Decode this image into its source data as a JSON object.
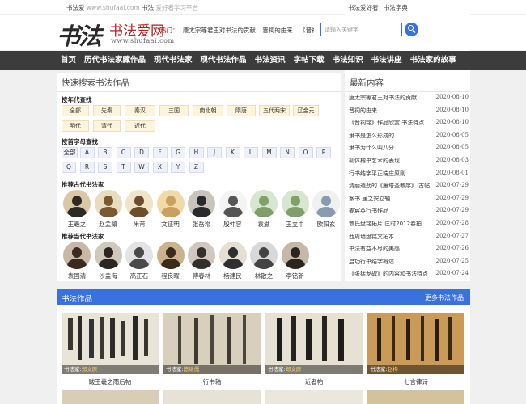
{
  "topbar": {
    "site": "书法爱",
    "url": "www.shufaai.com",
    "brand": "书法",
    "slogan": "爱好者学习平台",
    "links": [
      "书法爱好者",
      "书法字典"
    ]
  },
  "header": {
    "logo_text": "书法",
    "logo_red": "书法爱网",
    "logo_url": "www.shufaai.com",
    "hot_label": "热门：",
    "hot_items": [
      "唐太宗等君王对书法的贡献",
      "晋祠的由来",
      "《晋祠"
    ],
    "search_placeholder": "请输入关键字"
  },
  "nav": [
    "首页",
    "历代书法家藏作品",
    "现代书法家",
    "现代书法作品",
    "书法资讯",
    "字帖下载",
    "书法知识",
    "书法讲座",
    "书法家的故事"
  ],
  "search_panel": {
    "title": "快速搜索书法作品",
    "dynasty_title": "按年代查找",
    "dynasties": [
      "全部",
      "先秦",
      "秦汉",
      "三国",
      "南北朝",
      "隋唐",
      "五代两宋",
      "辽金元",
      "明代",
      "清代",
      "近代"
    ],
    "letter_title": "按首字母查找",
    "letters": [
      "全部",
      "A",
      "B",
      "C",
      "D",
      "F",
      "G",
      "H",
      "J",
      "K",
      "L",
      "M",
      "N",
      "O",
      "P",
      "Q",
      "R",
      "S",
      "T",
      "W",
      "X",
      "Y",
      "Z"
    ],
    "ancient_title": "推荐古代书法家",
    "ancient": [
      "王羲之",
      "赵孟頫",
      "米芾",
      "文征明",
      "张岳崧",
      "殷仲容",
      "袁滋",
      "王立中",
      "欧阳玄"
    ],
    "modern_title": "推荐当代书法家",
    "modern": [
      "袁国清",
      "沙孟海",
      "高正石",
      "程良曜",
      "傅春林",
      "杨建民",
      "林散之",
      "李铭新"
    ]
  },
  "latest": {
    "title": "最新内容",
    "items": [
      {
        "title": "唐太宗等君王对书法的贡献",
        "date": "2020-08-10"
      },
      {
        "title": "晋祠的由来",
        "date": "2020-08-10"
      },
      {
        "title": "《晋祠铭》作品欣赏 书法特点",
        "date": "2020-08-10"
      },
      {
        "title": "隶书是怎么形成的",
        "date": "2020-08-05"
      },
      {
        "title": "隶书为什么叫八分",
        "date": "2020-08-05"
      },
      {
        "title": "柳体楷书艺术的表现",
        "date": "2020-08-03"
      },
      {
        "title": "行书结字平正端庄原则",
        "date": "2020-08-01"
      },
      {
        "title": "清丽遒劲的《雁塔圣教序》 古帖",
        "date": "2020-07-29"
      },
      {
        "title": "篆书 居之安立轴",
        "date": "2020-07-29"
      },
      {
        "title": "姜宸英行书作品",
        "date": "2020-07-29"
      },
      {
        "title": "敦氏盘铭拓片 匡时2012春拍",
        "date": "2020-07-28"
      },
      {
        "title": "西周墙盘铭文拓本",
        "date": "2020-07-27"
      },
      {
        "title": "书法有益不尽的美感",
        "date": "2020-07-26"
      },
      {
        "title": "启功行书结字概述",
        "date": "2020-07-25"
      },
      {
        "title": "《张猛龙碑》的内容和书法特点",
        "date": "2020-07-24"
      }
    ]
  },
  "works": {
    "title": "书法作品",
    "more": "更多书法作品",
    "items": [
      {
        "caption_label": "书法家:",
        "artist": "郑文原",
        "name": "跋王羲之雨后帖"
      },
      {
        "caption_label": "书法家:",
        "artist": "陈继儒",
        "name": "行书轴"
      },
      {
        "caption_label": "书法家:",
        "artist": "郑文原",
        "name": "近者帖"
      },
      {
        "caption_label": "书法家:",
        "artist": "赵构",
        "name": "七言律诗"
      }
    ]
  }
}
